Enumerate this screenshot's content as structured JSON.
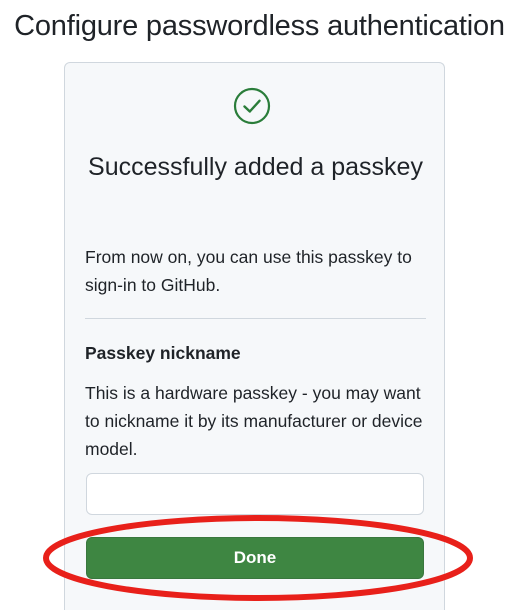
{
  "page": {
    "title": "Configure passwordless authentication"
  },
  "card": {
    "status_icon": "check-circle-icon",
    "success_title": "Successfully added a passkey",
    "success_description": "From now on, you can use this passkey to sign-in to GitHub.",
    "nickname": {
      "label": "Passkey nickname",
      "help_text": "This is a hardware passkey - you may want to nickname it by its manufacturer or device model.",
      "value": "",
      "placeholder": ""
    },
    "done_button_label": "Done"
  },
  "annotation": {
    "type": "ellipse-highlight",
    "target": "done-button",
    "color": "#e8201a"
  },
  "colors": {
    "success_green": "#3e8642",
    "check_icon": "#2a7d3a",
    "border": "#d0d7de",
    "card_bg": "#f6f8fa"
  }
}
